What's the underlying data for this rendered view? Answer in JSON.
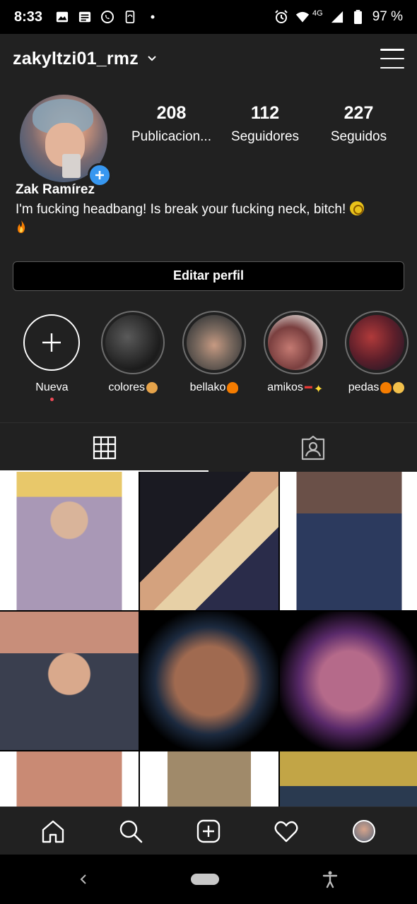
{
  "status_bar": {
    "time": "8:33",
    "network": "4G",
    "battery": "97 %",
    "left_icons": [
      "gallery-icon",
      "message-icon",
      "whatsapp-icon",
      "phone-sync-icon",
      "dot-icon"
    ],
    "right_icons": [
      "alarm-icon",
      "wifi-icon",
      "signal-icon",
      "battery-icon"
    ]
  },
  "header": {
    "username": "zakyltzi01_rmz"
  },
  "profile": {
    "stats": [
      {
        "value": "208",
        "label": "Publicacion..."
      },
      {
        "value": "112",
        "label": "Seguidores"
      },
      {
        "value": "227",
        "label": "Seguidos"
      }
    ],
    "name": "Zak Ramírez",
    "bio": "I'm fucking headbang! Is break your fucking neck, bitch!",
    "edit_button": "Editar perfil"
  },
  "highlights": [
    {
      "label": "Nueva"
    },
    {
      "label": "colores"
    },
    {
      "label": "bellako"
    },
    {
      "label": "amikos"
    },
    {
      "label": "pedas"
    }
  ],
  "tabs": [
    "grid-icon",
    "tagged-icon"
  ],
  "colors": {
    "background": "#212121",
    "accent_blue": "#3797f0",
    "notification_red": "#ed4956"
  }
}
